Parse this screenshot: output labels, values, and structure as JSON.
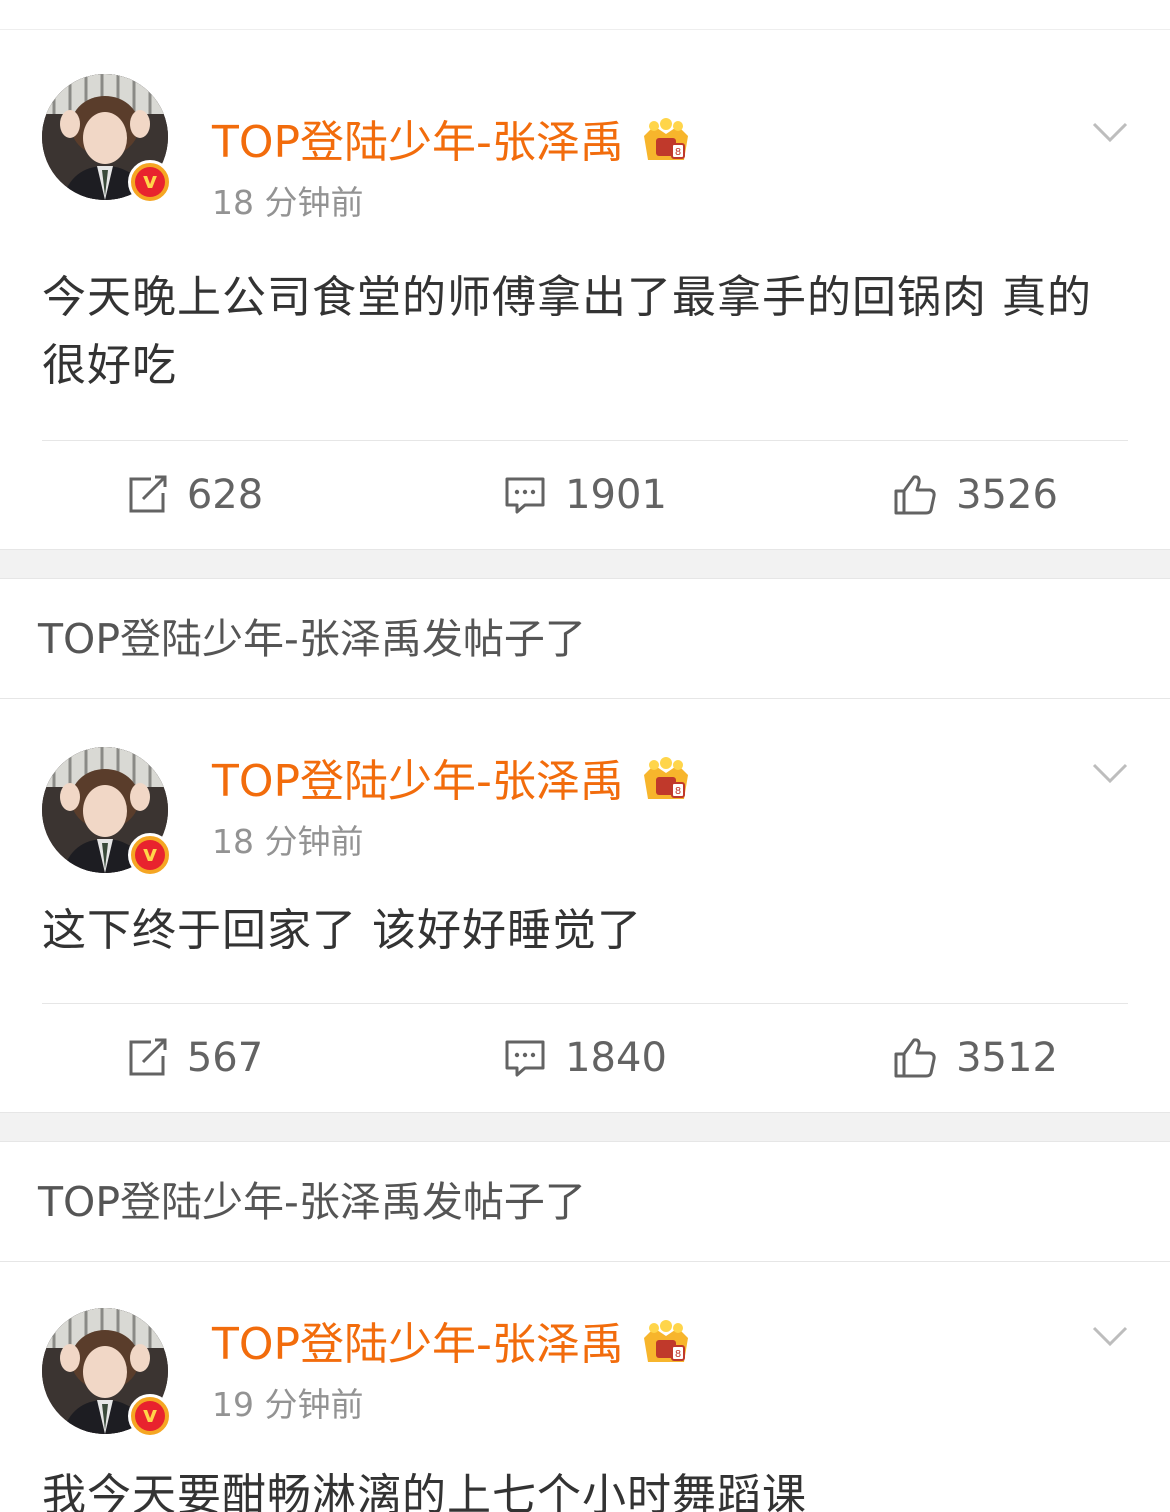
{
  "colors": {
    "username": "#f26c0c",
    "timestamp": "#939393",
    "body_text": "#333333",
    "action_text": "#636363",
    "separator_bg": "#f2f2f2",
    "verified_badge": "#f5a623"
  },
  "icons": {
    "verified": "verified-v-badge-icon",
    "crown": "crown-membership-icon",
    "menu": "chevron-down-icon",
    "repost": "repost-icon",
    "comment": "comment-icon",
    "like": "thumbs-up-icon"
  },
  "posts": [
    {
      "username": "TOP登陆少年-张泽禹",
      "time": "18 分钟前",
      "text": "今天晚上公司食堂的师傅拿出了最拿手的回锅肉 真的很好吃",
      "reposts": "628",
      "comments": "1901",
      "likes": "3526"
    },
    {
      "notice": "TOP登陆少年-张泽禹发帖子了",
      "username": "TOP登陆少年-张泽禹",
      "time": "18 分钟前",
      "text": "这下终于回家了 该好好睡觉了",
      "reposts": "567",
      "comments": "1840",
      "likes": "3512"
    },
    {
      "notice": "TOP登陆少年-张泽禹发帖子了",
      "username": "TOP登陆少年-张泽禹",
      "time": "19 分钟前",
      "text": "我今天要酣畅淋漓的上七个小时舞蹈课"
    }
  ]
}
